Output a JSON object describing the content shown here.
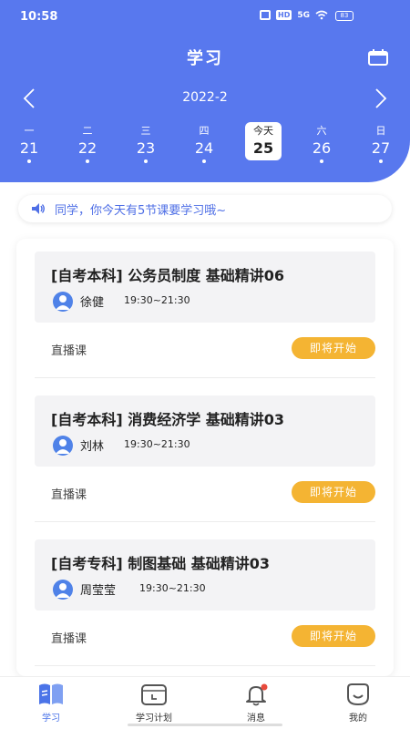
{
  "status": {
    "time": "10:58",
    "hd": "HD",
    "signal": "5G",
    "battery": "83"
  },
  "header": {
    "title": "学习",
    "month": "2022-2"
  },
  "week": [
    {
      "weekday": "一",
      "date": "21"
    },
    {
      "weekday": "二",
      "date": "22"
    },
    {
      "weekday": "三",
      "date": "23"
    },
    {
      "weekday": "四",
      "date": "24"
    },
    {
      "weekday": "今天",
      "date": "25",
      "today": true
    },
    {
      "weekday": "六",
      "date": "26"
    },
    {
      "weekday": "日",
      "date": "27"
    }
  ],
  "notice": "同学，你今天有5节课要学习哦~",
  "courses": [
    {
      "title": "[自考本科] 公务员制度 基础精讲06",
      "teacher": "徐健",
      "time": "19:30~21:30",
      "type": "直播课",
      "button": "即将开始"
    },
    {
      "title": "[自考本科] 消费经济学 基础精讲03",
      "teacher": "刘林",
      "time": "19:30~21:30",
      "type": "直播课",
      "button": "即将开始"
    },
    {
      "title": "[自考专科] 制图基础 基础精讲03",
      "teacher": "周莹莹",
      "time": "19:30~21:30",
      "type": "直播课",
      "button": "即将开始"
    }
  ],
  "tabs": [
    {
      "label": "学习",
      "icon": "book-icon",
      "active": true
    },
    {
      "label": "学习计划",
      "icon": "calendar-plan-icon"
    },
    {
      "label": "消息",
      "icon": "bell-icon"
    },
    {
      "label": "我的",
      "icon": "smile-icon"
    }
  ],
  "colors": {
    "primary": "#5878ee",
    "accent": "#f4b433",
    "notice_text": "#4f6fe6"
  }
}
